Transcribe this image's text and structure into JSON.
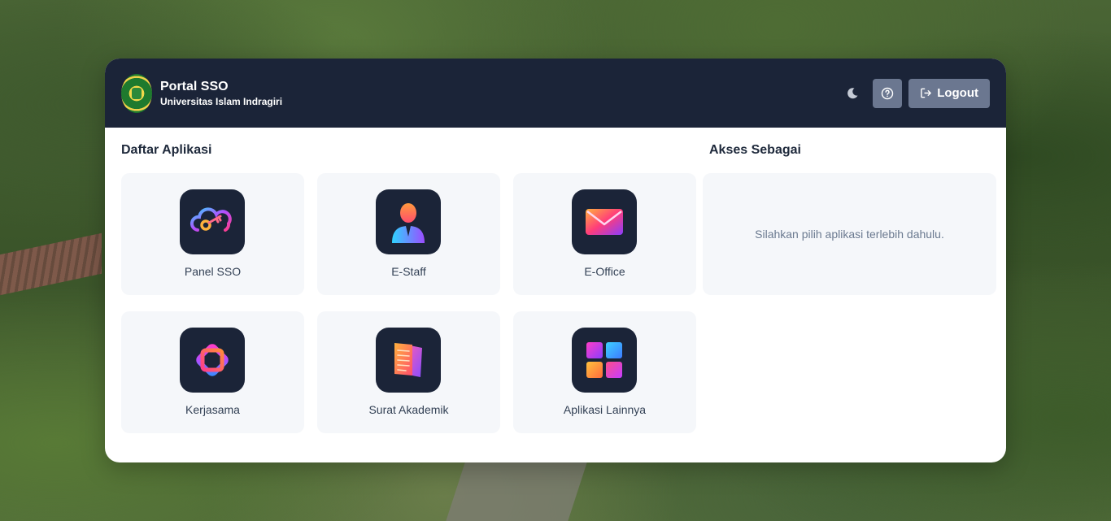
{
  "header": {
    "title": "Portal SSO",
    "subtitle": "Universitas Islam Indragiri",
    "logout_label": "Logout",
    "logo_icon": "university-seal-icon",
    "theme_icon": "moon-icon",
    "help_icon": "help-circle-icon",
    "logout_icon": "logout-icon"
  },
  "apps_section": {
    "title": "Daftar Aplikasi",
    "items": [
      {
        "label": "Panel SSO",
        "icon": "cloud-key-icon"
      },
      {
        "label": "E-Staff",
        "icon": "staff-person-icon"
      },
      {
        "label": "E-Office",
        "icon": "envelope-icon"
      },
      {
        "label": "Kerjasama",
        "icon": "interlocked-shapes-icon"
      },
      {
        "label": "Surat Akademik",
        "icon": "document-stack-icon"
      },
      {
        "label": "Aplikasi Lainnya",
        "icon": "app-grid-icon"
      }
    ]
  },
  "akses_section": {
    "title": "Akses Sebagai",
    "empty_message": "Silahkan pilih aplikasi terlebih dahulu."
  },
  "colors": {
    "header_bg": "#1b2438",
    "button_bg": "#6b7790",
    "tile_bg": "#f5f7fa",
    "icon_bg": "#1b2438"
  }
}
